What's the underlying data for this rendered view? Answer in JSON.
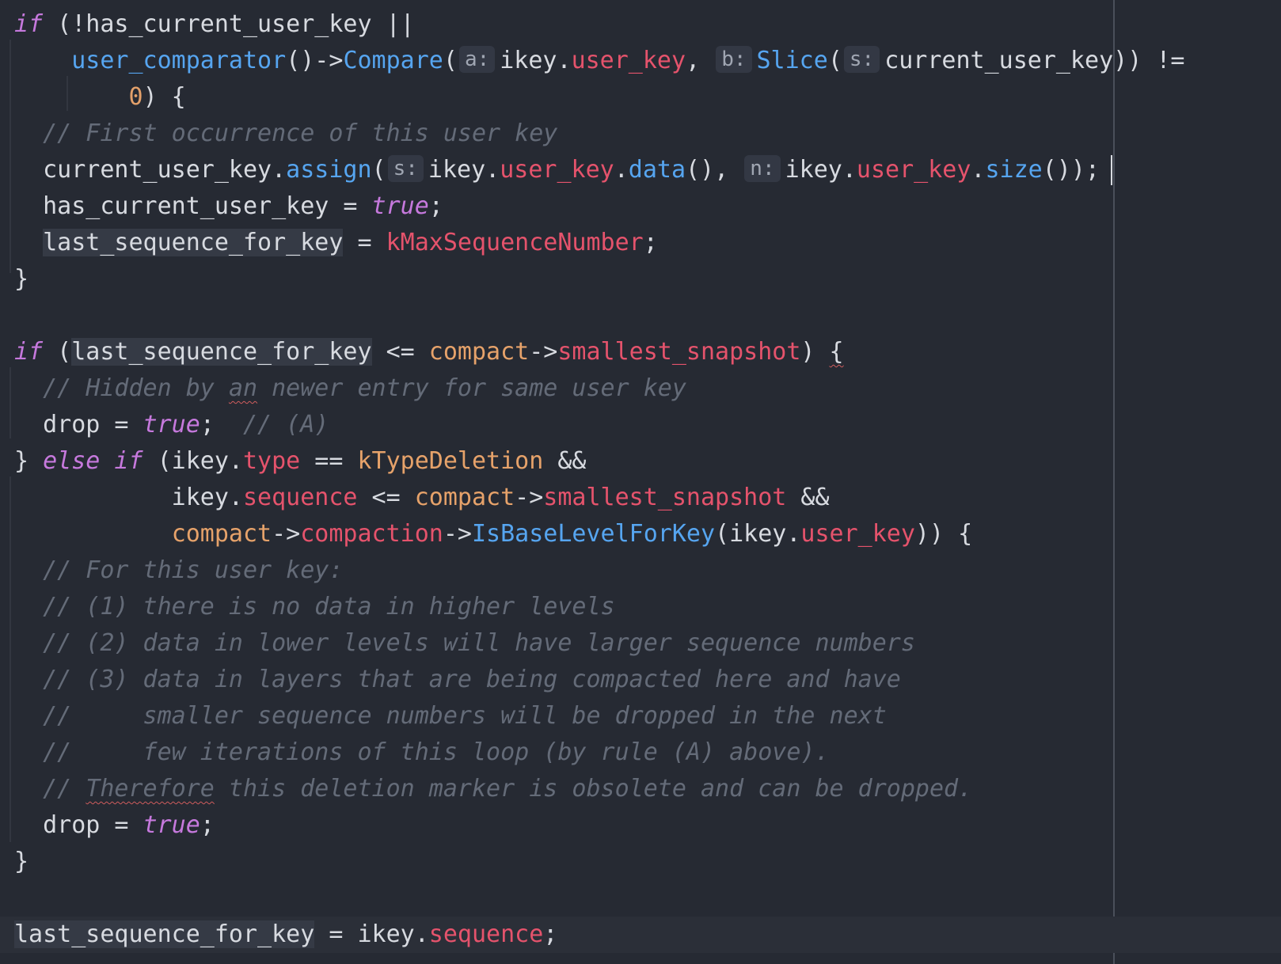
{
  "editor": {
    "lines": [
      {
        "tokens": [
          {
            "t": "if",
            "c": "kw"
          },
          {
            "t": " (!has_current_user_key ||",
            "c": "plain"
          }
        ]
      },
      {
        "tokens": [
          {
            "t": "    ",
            "c": "plain"
          },
          {
            "t": "user_comparator",
            "c": "fn"
          },
          {
            "t": "()->",
            "c": "plain"
          },
          {
            "t": "Compare",
            "c": "fn"
          },
          {
            "t": "(",
            "c": "plain"
          },
          {
            "hint": "a:"
          },
          {
            "t": "ikey.",
            "c": "plain"
          },
          {
            "t": "user_key",
            "c": "field"
          },
          {
            "t": ", ",
            "c": "plain"
          },
          {
            "hint": "b:"
          },
          {
            "t": "Slice",
            "c": "fn"
          },
          {
            "t": "(",
            "c": "plain"
          },
          {
            "hint": "s:"
          },
          {
            "t": "current_user_key)) !=",
            "c": "plain"
          }
        ]
      },
      {
        "tokens": [
          {
            "t": "        ",
            "c": "plain"
          },
          {
            "t": "0",
            "c": "num"
          },
          {
            "t": ") {",
            "c": "plain"
          }
        ]
      },
      {
        "tokens": [
          {
            "t": "  ",
            "c": "plain"
          },
          {
            "t": "// First occurrence of this user key",
            "c": "comment"
          }
        ]
      },
      {
        "tokens": [
          {
            "t": "  current_user_key.",
            "c": "plain"
          },
          {
            "t": "assign",
            "c": "fn"
          },
          {
            "t": "(",
            "c": "plain"
          },
          {
            "hint": "s:"
          },
          {
            "t": "ikey.",
            "c": "plain"
          },
          {
            "t": "user_key",
            "c": "field"
          },
          {
            "t": ".",
            "c": "plain"
          },
          {
            "t": "data",
            "c": "fn"
          },
          {
            "t": "(), ",
            "c": "plain"
          },
          {
            "hint": "n:"
          },
          {
            "t": "ikey.",
            "c": "plain"
          },
          {
            "t": "user_key",
            "c": "field"
          },
          {
            "t": ".",
            "c": "plain"
          },
          {
            "t": "size",
            "c": "fn"
          },
          {
            "t": "());",
            "c": "plain"
          }
        ]
      },
      {
        "tokens": [
          {
            "t": "  has_current_user_key = ",
            "c": "plain"
          },
          {
            "t": "true",
            "c": "kw"
          },
          {
            "t": ";",
            "c": "plain"
          }
        ]
      },
      {
        "tokens": [
          {
            "t": "  ",
            "c": "plain"
          },
          {
            "t": "last_sequence_for_key",
            "c": "plain",
            "hl": true
          },
          {
            "t": " = ",
            "c": "plain"
          },
          {
            "t": "kMaxSequenceNumber",
            "c": "const"
          },
          {
            "t": ";",
            "c": "plain"
          }
        ]
      },
      {
        "tokens": [
          {
            "t": "}",
            "c": "plain"
          }
        ]
      },
      {
        "tokens": []
      },
      {
        "tokens": [
          {
            "t": "if",
            "c": "kw"
          },
          {
            "t": " (",
            "c": "plain"
          },
          {
            "t": "last_sequence_for_key",
            "c": "plain",
            "hl": true
          },
          {
            "t": " <= ",
            "c": "plain"
          },
          {
            "t": "compact",
            "c": "var"
          },
          {
            "t": "->",
            "c": "plain"
          },
          {
            "t": "smallest_snapshot",
            "c": "field"
          },
          {
            "t": ") ",
            "c": "plain"
          },
          {
            "t": "{",
            "c": "plain",
            "sq": true
          }
        ]
      },
      {
        "tokens": [
          {
            "t": "  ",
            "c": "plain"
          },
          {
            "t": "// Hidden by ",
            "c": "comment"
          },
          {
            "t": "an",
            "c": "comment",
            "sq": true
          },
          {
            "t": " newer entry for same user key",
            "c": "comment"
          }
        ]
      },
      {
        "tokens": [
          {
            "t": "  drop = ",
            "c": "plain"
          },
          {
            "t": "true",
            "c": "kw"
          },
          {
            "t": ";  ",
            "c": "plain"
          },
          {
            "t": "// (A)",
            "c": "comment"
          }
        ]
      },
      {
        "tokens": [
          {
            "t": "} ",
            "c": "plain"
          },
          {
            "t": "else if",
            "c": "kw"
          },
          {
            "t": " (ikey.",
            "c": "plain"
          },
          {
            "t": "type",
            "c": "field"
          },
          {
            "t": " == ",
            "c": "plain"
          },
          {
            "t": "kTypeDeletion",
            "c": "type"
          },
          {
            "t": " &&",
            "c": "plain"
          }
        ]
      },
      {
        "tokens": [
          {
            "t": "           ikey.",
            "c": "plain"
          },
          {
            "t": "sequence",
            "c": "field"
          },
          {
            "t": " <= ",
            "c": "plain"
          },
          {
            "t": "compact",
            "c": "var"
          },
          {
            "t": "->",
            "c": "plain"
          },
          {
            "t": "smallest_snapshot",
            "c": "field"
          },
          {
            "t": " &&",
            "c": "plain"
          }
        ]
      },
      {
        "tokens": [
          {
            "t": "           ",
            "c": "plain"
          },
          {
            "t": "compact",
            "c": "var"
          },
          {
            "t": "->",
            "c": "plain"
          },
          {
            "t": "compaction",
            "c": "field"
          },
          {
            "t": "->",
            "c": "plain"
          },
          {
            "t": "IsBaseLevelForKey",
            "c": "fn"
          },
          {
            "t": "(ikey.",
            "c": "plain"
          },
          {
            "t": "user_key",
            "c": "field"
          },
          {
            "t": ")) {",
            "c": "plain"
          }
        ]
      },
      {
        "tokens": [
          {
            "t": "  ",
            "c": "plain"
          },
          {
            "t": "// For this user key:",
            "c": "comment"
          }
        ]
      },
      {
        "tokens": [
          {
            "t": "  ",
            "c": "plain"
          },
          {
            "t": "// (1) there is no data in higher levels",
            "c": "comment"
          }
        ]
      },
      {
        "tokens": [
          {
            "t": "  ",
            "c": "plain"
          },
          {
            "t": "// (2) data in lower levels will have larger sequence numbers",
            "c": "comment"
          }
        ]
      },
      {
        "tokens": [
          {
            "t": "  ",
            "c": "plain"
          },
          {
            "t": "// (3) data in layers that are being compacted here and have",
            "c": "comment"
          }
        ]
      },
      {
        "tokens": [
          {
            "t": "  ",
            "c": "plain"
          },
          {
            "t": "//     smaller sequence numbers will be dropped in the next",
            "c": "comment"
          }
        ]
      },
      {
        "tokens": [
          {
            "t": "  ",
            "c": "plain"
          },
          {
            "t": "//     few iterations of this loop (by rule (A) above).",
            "c": "comment"
          }
        ]
      },
      {
        "tokens": [
          {
            "t": "  ",
            "c": "plain"
          },
          {
            "t": "// ",
            "c": "comment"
          },
          {
            "t": "Therefore",
            "c": "comment",
            "sq": true
          },
          {
            "t": " this deletion marker is obsolete and can be dropped.",
            "c": "comment"
          }
        ]
      },
      {
        "tokens": [
          {
            "t": "  drop = ",
            "c": "plain"
          },
          {
            "t": "true",
            "c": "kw"
          },
          {
            "t": ";",
            "c": "plain"
          }
        ]
      },
      {
        "tokens": [
          {
            "t": "}",
            "c": "plain"
          }
        ]
      },
      {
        "tokens": []
      },
      {
        "tokens": [
          {
            "t": "last_sequence_for_key",
            "c": "plain",
            "hl": true
          },
          {
            "t": " = ikey.",
            "c": "plain"
          },
          {
            "t": "sequence",
            "c": "field"
          },
          {
            "t": ";",
            "c": "plain"
          }
        ]
      }
    ]
  }
}
